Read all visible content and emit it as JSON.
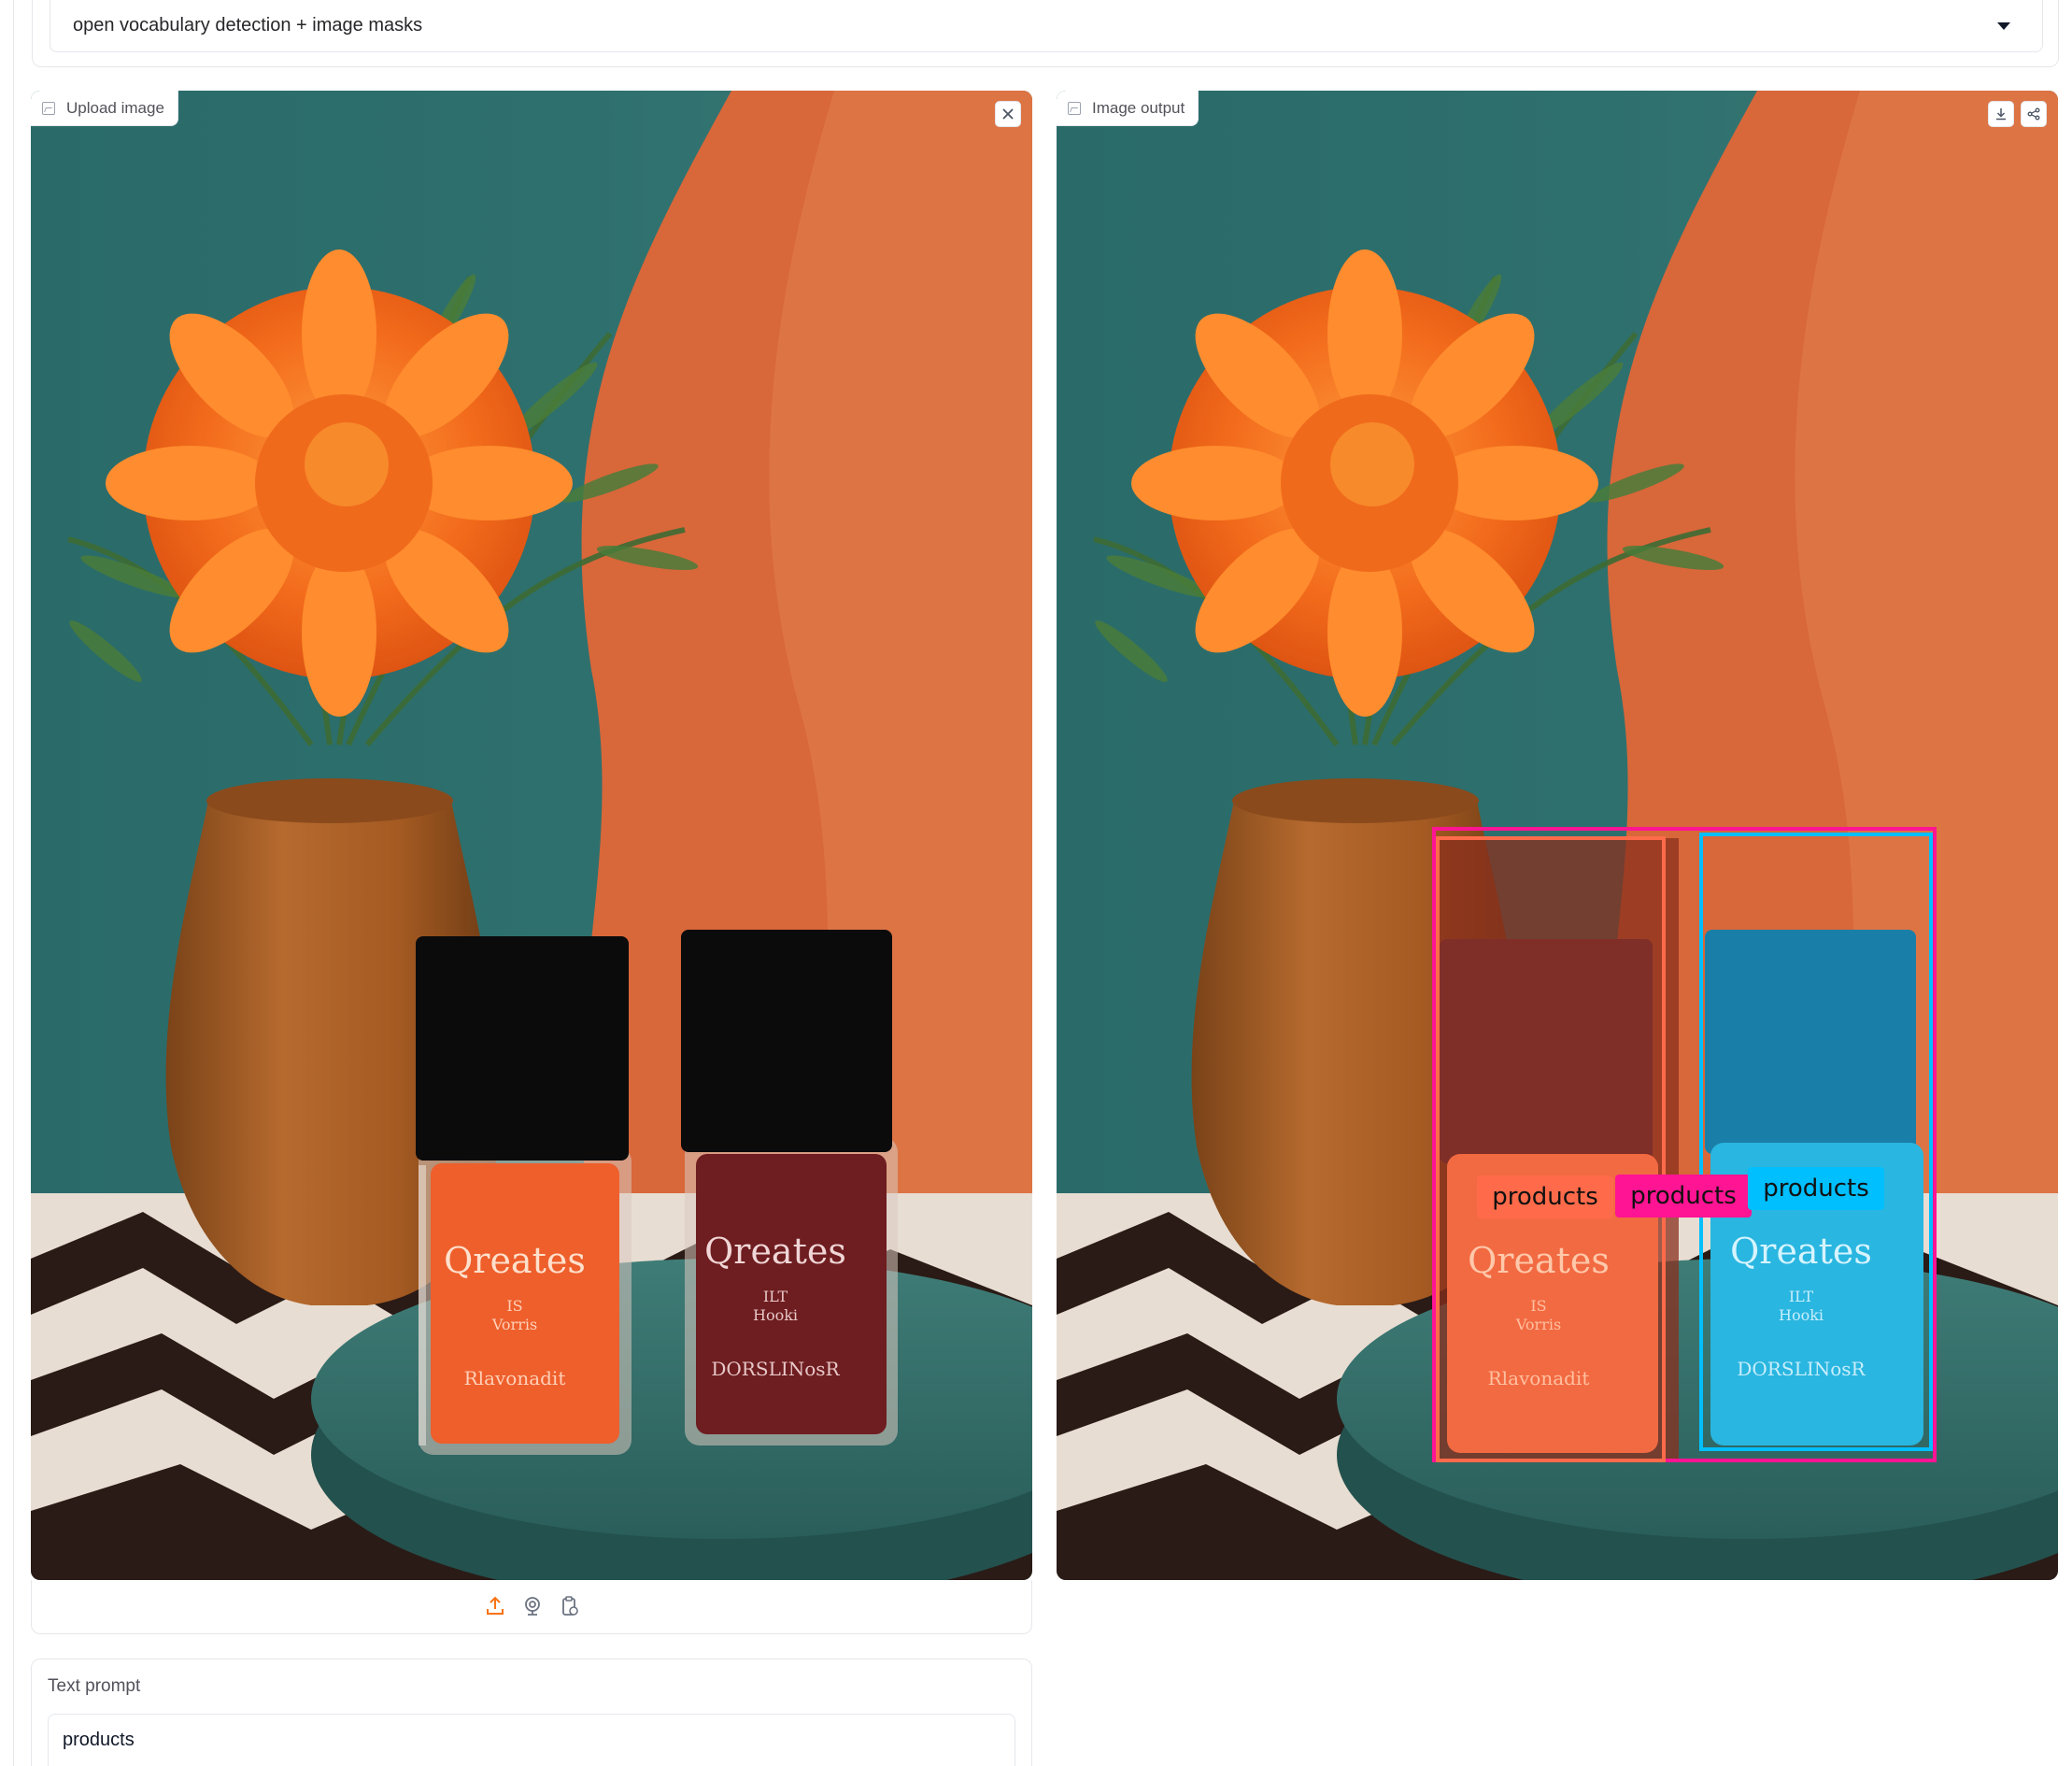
{
  "mode_dropdown": {
    "value": "open vocabulary detection + image masks"
  },
  "input_panel": {
    "label": "Upload image",
    "clear_icon": "close-icon",
    "image_icon": "image-icon"
  },
  "output_panel": {
    "label": "Image output",
    "download_icon": "download-icon",
    "share_icon": "share-icon",
    "image_icon": "image-icon"
  },
  "scene": {
    "left_bottle_text": "Qreates",
    "left_bottle_sub1": "IS",
    "left_bottle_sub2": "Vorris",
    "left_bottle_footer": "Rlavonadit",
    "right_bottle_text": "Qreates",
    "right_bottle_sub1": "ILT",
    "right_bottle_sub2": "Hooki",
    "right_bottle_footer": "DORSLINosR"
  },
  "detections": [
    {
      "label": "products",
      "color": "#ff6b4a"
    },
    {
      "label": "products",
      "color": "#ff1493"
    },
    {
      "label": "products",
      "color": "#00bfff"
    }
  ],
  "upload_toolbar": {
    "icons": [
      "upload-icon",
      "webcam-icon",
      "clipboard-icon"
    ],
    "accent": "#f97316"
  },
  "text_prompt": {
    "label": "Text prompt",
    "value": "products"
  }
}
